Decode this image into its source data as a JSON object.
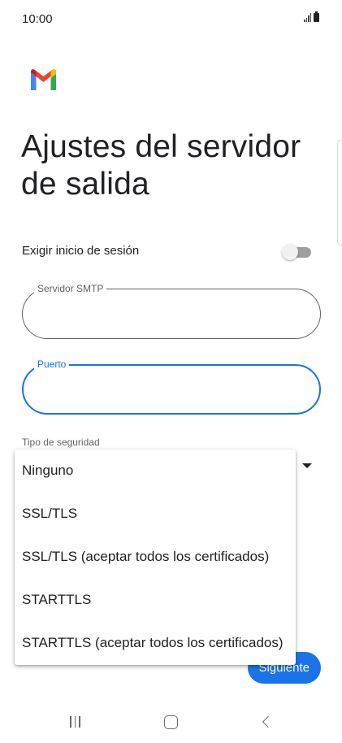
{
  "status_bar": {
    "time": "10:00",
    "signal_icon": "signal-icon",
    "battery_icon": "battery-icon"
  },
  "app": {
    "logo_icon": "gmail-logo"
  },
  "page": {
    "title": "Ajustes del servidor\nde salida"
  },
  "login_toggle": {
    "label": "Exigir inicio de sesión",
    "enabled": false
  },
  "smtp_field": {
    "label": "Servidor SMTP",
    "value": ""
  },
  "port_field": {
    "label": "Puerto",
    "value": "",
    "focused": true
  },
  "security": {
    "label": "Tipo de seguridad",
    "options": [
      "Ninguno",
      "SSL/TLS",
      "SSL/TLS (aceptar todos los certificados)",
      "STARTTLS",
      "STARTTLS (aceptar todos los certificados)"
    ]
  },
  "actions": {
    "next_label": "Siguiente"
  },
  "colors": {
    "accent": "#1a73e8",
    "text": "#202124",
    "muted": "#5f6368"
  }
}
